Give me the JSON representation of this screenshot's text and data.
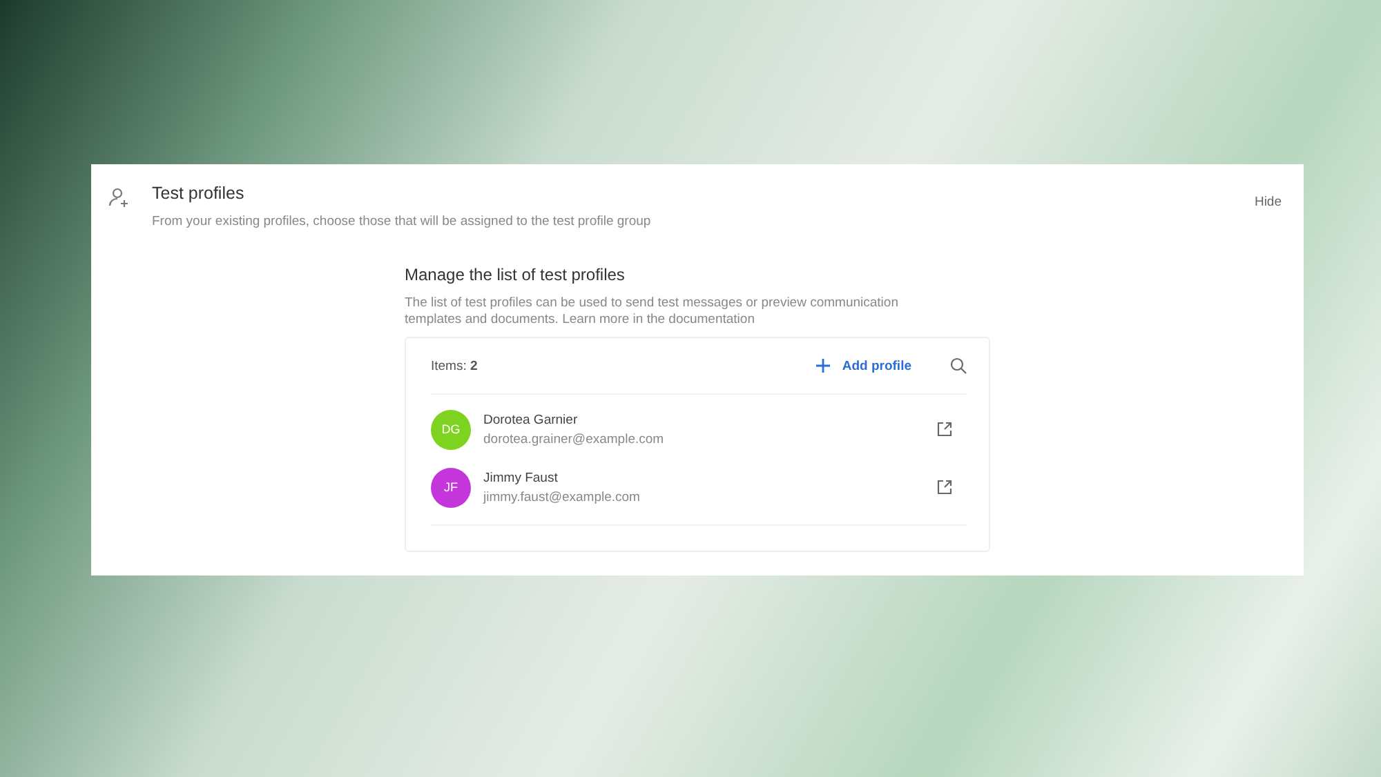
{
  "section": {
    "title": "Test profiles",
    "description": "From your existing profiles, choose those that will be assigned to the test profile group",
    "hide_label": "Hide"
  },
  "manage": {
    "title": "Manage the list of test profiles",
    "description": "The list of test profiles can be used to send test messages or preview communication templates and documents. Learn more in the documentation"
  },
  "list": {
    "count_label": "Items: **2**",
    "add_label": "Add profile",
    "profiles": [
      {
        "initials": "DG",
        "name": "Dorotea Garnier",
        "email": "dorotea.grainer@example.com",
        "color": "#7ed321"
      },
      {
        "initials": "JF",
        "name": "Jimmy Faust",
        "email": "jimmy.faust@example.com",
        "color": "#c535dc"
      }
    ]
  }
}
